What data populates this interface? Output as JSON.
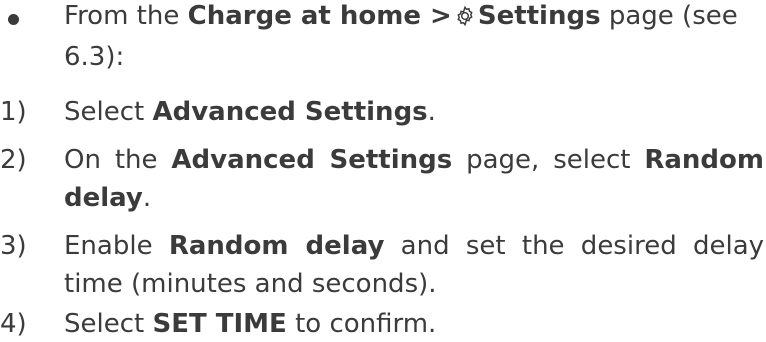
{
  "intro": {
    "l1_a": "From the ",
    "l1_b": "Charge at home >",
    "l1_c": "Settings",
    "l1_d": " page (see",
    "l2": "6.3):"
  },
  "steps": [
    {
      "num": "1)",
      "a": "Select ",
      "b": "Advanced Settings",
      "c": "."
    },
    {
      "num": "2)",
      "a": "On the ",
      "b": "Advanced Settings",
      "c": " page, select ",
      "d": "Random",
      "e": "delay",
      "f": "."
    },
    {
      "num": "3)",
      "a": "Enable ",
      "b": "Random delay",
      "c": " and set the desired delay",
      "d": "time (minutes and seconds)."
    },
    {
      "num": "4)",
      "a": "Select ",
      "b": "SET TIME",
      "c": " to confirm."
    }
  ]
}
